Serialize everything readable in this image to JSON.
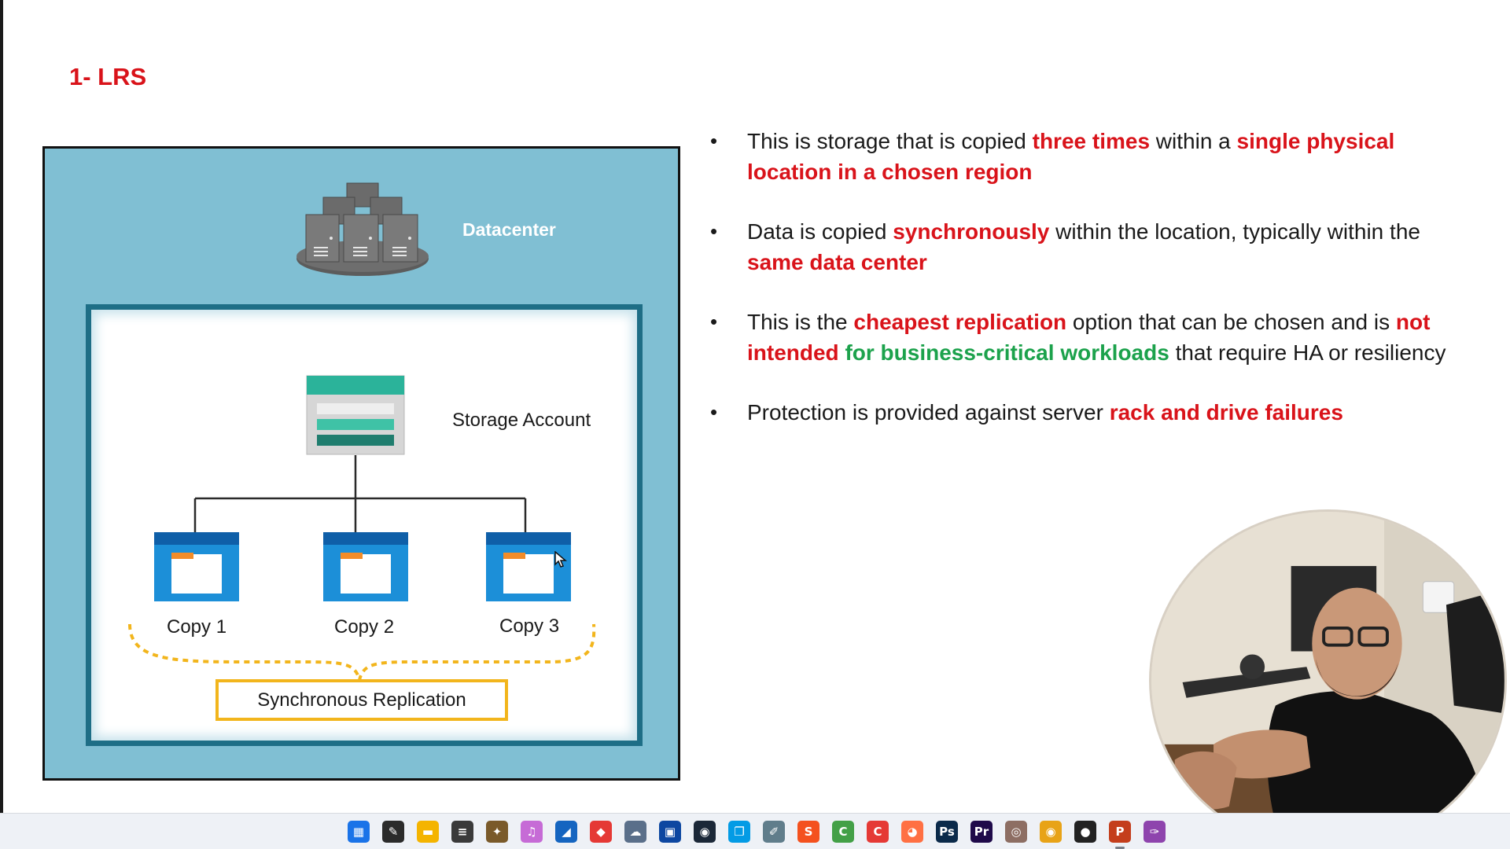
{
  "slide": {
    "title": "1- LRS"
  },
  "diagram": {
    "datacenter_label": "Datacenter",
    "storage_account_label": "Storage Account",
    "copies": [
      "Copy 1",
      "Copy 2",
      "Copy 3"
    ],
    "replication_label": "Synchronous Replication",
    "colors": {
      "outer_bg": "#80bfd3",
      "inner_border": "#1e6e86",
      "replication_border": "#f2b51c",
      "folder_blue": "#1c8fd8",
      "storage_teal": "#2bb39a"
    }
  },
  "bullets": [
    {
      "segments": [
        {
          "text": "This is storage that is copied ",
          "style": "normal"
        },
        {
          "text": "three times",
          "style": "red"
        },
        {
          "text": " within a ",
          "style": "normal"
        },
        {
          "text": "single physical location in a chosen region",
          "style": "red"
        }
      ]
    },
    {
      "segments": [
        {
          "text": "Data is copied ",
          "style": "normal"
        },
        {
          "text": "synchronously",
          "style": "red"
        },
        {
          "text": " within the location, typically within the ",
          "style": "normal"
        },
        {
          "text": "same data center",
          "style": "red"
        }
      ]
    },
    {
      "segments": [
        {
          "text": "This is the ",
          "style": "normal"
        },
        {
          "text": "cheapest replication",
          "style": "red"
        },
        {
          "text": " option that can be chosen and is ",
          "style": "normal"
        },
        {
          "text": "not intended",
          "style": "red"
        },
        {
          "text": " ",
          "style": "normal"
        },
        {
          "text": "for business-critical workloads",
          "style": "green"
        },
        {
          "text": " that require HA or resiliency",
          "style": "normal"
        }
      ]
    },
    {
      "segments": [
        {
          "text": "Protection is provided against server ",
          "style": "normal"
        },
        {
          "text": "rack and drive failures",
          "style": "red"
        }
      ]
    }
  ],
  "bullet_symbol": "•",
  "colors": {
    "highlight_red": "#d9131a",
    "highlight_green": "#1ca24c"
  },
  "webcam": {
    "description_name": "presenter-webcam"
  },
  "taskbar": {
    "apps": [
      {
        "name": "start-menu-icon",
        "glyph": "▦",
        "color": "#1a73e8",
        "active": false
      },
      {
        "name": "sticky-notes-icon",
        "glyph": "✎",
        "color": "#2b2b2b",
        "active": false
      },
      {
        "name": "file-explorer-icon",
        "glyph": "▬",
        "color": "#f4b400",
        "active": false
      },
      {
        "name": "layers-app-icon",
        "glyph": "≡",
        "color": "#3a3a3a",
        "active": false
      },
      {
        "name": "game-app-icon",
        "glyph": "✦",
        "color": "#7a5a2a",
        "active": false
      },
      {
        "name": "itunes-icon",
        "glyph": "♫",
        "color": "#c66bd6",
        "active": false
      },
      {
        "name": "sail-app-icon",
        "glyph": "◢",
        "color": "#1565c0",
        "active": false
      },
      {
        "name": "anydesk-icon",
        "glyph": "◆",
        "color": "#e53935",
        "active": false
      },
      {
        "name": "onedrive-icon",
        "glyph": "☁",
        "color": "#5a6f8a",
        "active": false
      },
      {
        "name": "remote-desktop-icon",
        "glyph": "▣",
        "color": "#0d47a1",
        "active": false
      },
      {
        "name": "steam-icon",
        "glyph": "◉",
        "color": "#1b2838",
        "active": false
      },
      {
        "name": "virtual-desktop-icon",
        "glyph": "❐",
        "color": "#039be5",
        "active": false
      },
      {
        "name": "pen-tool-icon",
        "glyph": "✐",
        "color": "#607d8b",
        "active": false
      },
      {
        "name": "s-app-icon",
        "glyph": "S",
        "color": "#f4511e",
        "active": false
      },
      {
        "name": "camtasia-icon",
        "glyph": "C",
        "color": "#43a047",
        "active": false
      },
      {
        "name": "c-app-icon",
        "glyph": "C",
        "color": "#e53935",
        "active": false
      },
      {
        "name": "firefox-icon",
        "glyph": "◕",
        "color": "#ff7043",
        "active": false
      },
      {
        "name": "photoshop-icon",
        "glyph": "Ps",
        "color": "#0b2a4a",
        "active": false
      },
      {
        "name": "premiere-icon",
        "glyph": "Pr",
        "color": "#1f0a4a",
        "active": false
      },
      {
        "name": "davinci-icon",
        "glyph": "◎",
        "color": "#8d6e63",
        "active": false
      },
      {
        "name": "chrome-icon",
        "glyph": "◉",
        "color": "#e8a317",
        "active": false
      },
      {
        "name": "obs-icon",
        "glyph": "●",
        "color": "#222222",
        "active": false
      },
      {
        "name": "powerpoint-icon",
        "glyph": "P",
        "color": "#c43e1c",
        "active": true
      },
      {
        "name": "pen-app-icon",
        "glyph": "✑",
        "color": "#8e44ad",
        "active": false
      }
    ]
  }
}
